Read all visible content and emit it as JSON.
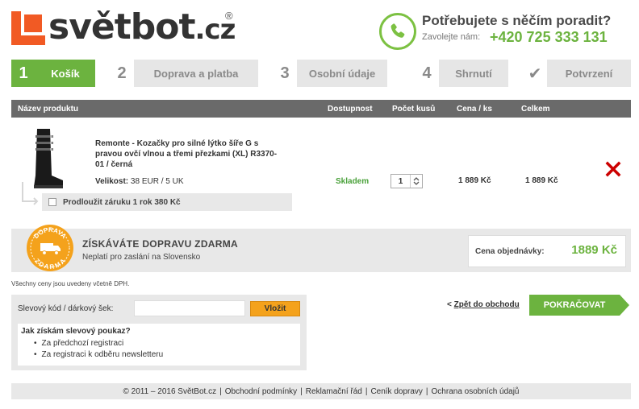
{
  "header": {
    "logo_text": "světbot",
    "logo_tld": ".cz",
    "logo_reg": "®",
    "help_title": "Potřebujete s něčím poradit?",
    "help_call": "Zavolejte nám:",
    "help_phone": "+420 725 333 131"
  },
  "steps": [
    {
      "num": "1",
      "label": "Košík",
      "active": true
    },
    {
      "num": "2",
      "label": "Doprava a platba",
      "active": false
    },
    {
      "num": "3",
      "label": "Osobní údaje",
      "active": false
    },
    {
      "num": "4",
      "label": "Shrnutí",
      "active": false
    },
    {
      "num": "✔",
      "label": "Potvrzení",
      "active": false
    }
  ],
  "table": {
    "headers": {
      "product": "Název produktu",
      "availability": "Dostupnost",
      "quantity": "Počet kusů",
      "unit_price": "Cena / ks",
      "total": "Celkem"
    },
    "item": {
      "name": "Remonte - Kozačky pro silné lýtko šíře G s pravou ovčí vlnou a třemi přezkami (XL) R3370-01 / černá",
      "size_label": "Velikost:",
      "size_value": "38 EUR / 5 UK",
      "availability": "Skladem",
      "quantity": "1",
      "unit_price": "1 889 Kč",
      "total": "1 889 Kč",
      "warranty_label": "Prodloužit záruku 1 rok 380 Kč"
    }
  },
  "shipping": {
    "badge_top": "DOPRAVA",
    "badge_bottom": "ZDARMA",
    "title": "ZÍSKÁVÁTE DOPRAVU ZDARMA",
    "subtitle": "Neplatí pro zaslání na Slovensko",
    "order_label": "Cena objednávky:",
    "order_value": "1889 Kč"
  },
  "vat_note": "Všechny ceny jsou uvedeny včetně DPH.",
  "coupon": {
    "label": "Slevový kód / dárkový šek:",
    "input_value": "",
    "button": "Vložit",
    "help_title": "Jak získám slevový poukaz?",
    "help_items": [
      "Za předchozí registraci",
      "Za registraci k odběru newsletteru"
    ]
  },
  "nav": {
    "back_prefix": "<",
    "back_link": "Zpět do obchodu",
    "continue": "POKRAČOVAT"
  },
  "footer": {
    "copyright": "© 2011 – 2016 SvětBot.cz",
    "links": [
      "Obchodní podmínky",
      "Reklamační řád",
      "Ceník dopravy",
      "Ochrana osobních údajů"
    ]
  },
  "colors": {
    "accent_green": "#6cb33f",
    "logo_orange": "#f15a24",
    "coupon_button": "#f4a21c",
    "remove_red": "#cc0000"
  }
}
